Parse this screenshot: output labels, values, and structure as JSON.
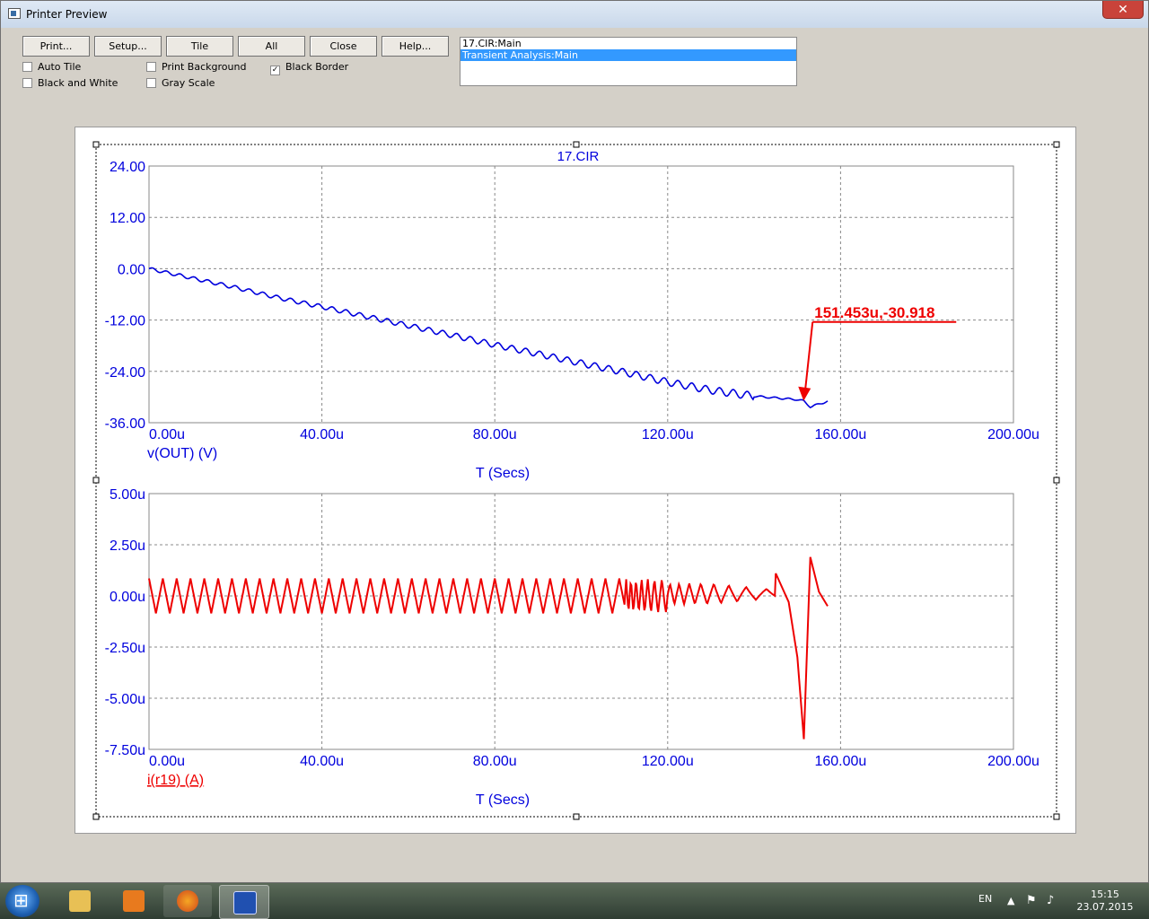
{
  "window": {
    "title": "Printer Preview"
  },
  "toolbar": {
    "buttons": [
      "Print...",
      "Setup...",
      "Tile",
      "All",
      "Close",
      "Help..."
    ],
    "checkboxes": [
      {
        "label": "Auto Tile",
        "checked": false
      },
      {
        "label": "Black and White",
        "checked": false
      },
      {
        "label": "Print Background",
        "checked": false
      },
      {
        "label": "Gray Scale",
        "checked": false
      },
      {
        "label": "Black Border",
        "checked": true
      }
    ]
  },
  "analysis_list": {
    "items": [
      "17.CIR:Main",
      "Transient Analysis:Main"
    ],
    "selected": "Transient Analysis:Main"
  },
  "chart_data": [
    {
      "type": "line",
      "title": "17.CIR",
      "xlabel": "T (Secs)",
      "ylabel": "v(OUT) (V)",
      "xlim": [
        0,
        200
      ],
      "x_unit": "u",
      "ylim": [
        -36,
        24
      ],
      "x_ticks": [
        "0.00u",
        "40.00u",
        "80.00u",
        "120.00u",
        "160.00u",
        "200.00u"
      ],
      "y_ticks": [
        "24.00",
        "12.00",
        "0.00",
        "-12.00",
        "-24.00",
        "-36.00"
      ],
      "grid": true,
      "color": "#0000dd",
      "series": [
        {
          "name": "v(OUT) (V)",
          "x": [
            0,
            10,
            20,
            30,
            40,
            50,
            60,
            70,
            80,
            90,
            100,
            110,
            120,
            130,
            140,
            150,
            151.453,
            153,
            157
          ],
          "y": [
            0,
            -2.2,
            -4.4,
            -6.8,
            -8.9,
            -11.1,
            -13.3,
            -15.5,
            -17.8,
            -19.9,
            -22.1,
            -24.2,
            -26.5,
            -28.4,
            -29.8,
            -30.6,
            -30.918,
            -32.3,
            -31.0
          ]
        }
      ],
      "annotation": {
        "text": "151.453u,-30.918",
        "x": 151.453,
        "y": -30.918,
        "color": "#ee0000"
      }
    },
    {
      "type": "line",
      "xlabel": "T (Secs)",
      "ylabel": "i(r19) (A)",
      "xlim": [
        0,
        200
      ],
      "x_unit": "u",
      "ylim": [
        -7.5,
        5.0
      ],
      "y_unit": "u",
      "x_ticks": [
        "0.00u",
        "40.00u",
        "80.00u",
        "120.00u",
        "160.00u",
        "200.00u"
      ],
      "y_ticks": [
        "5.00u",
        "2.50u",
        "0.00u",
        "-2.50u",
        "-5.00u",
        "-7.50u"
      ],
      "grid": true,
      "color": "#ee0000",
      "series": [
        {
          "name": "i(r19) (A)",
          "x": [
            0,
            20,
            40,
            60,
            80,
            100,
            120,
            140,
            145,
            148,
            150,
            151.5,
            153,
            155,
            157
          ],
          "y": [
            0.4,
            0.0,
            0.0,
            0.0,
            0.0,
            0.0,
            0.1,
            0.2,
            1.1,
            -0.3,
            -3.0,
            -7.0,
            1.9,
            0.2,
            -0.5
          ]
        }
      ]
    }
  ],
  "taskbar": {
    "language": "EN",
    "time": "15:15",
    "date": "23.07.2015"
  }
}
